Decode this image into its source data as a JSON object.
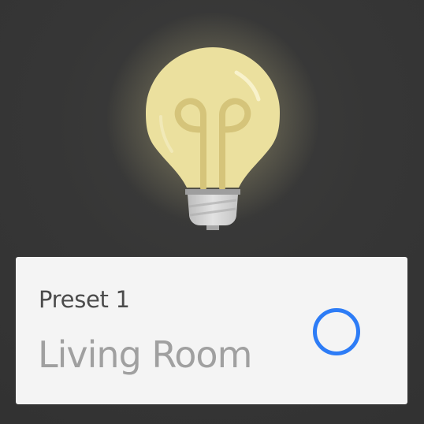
{
  "card": {
    "preset_label": "Preset 1",
    "room_name": "Living Room",
    "selected": false
  },
  "icons": {
    "bulb": "light-bulb-icon",
    "radio": "radio-button-icon"
  },
  "colors": {
    "background": "#333333",
    "bulb_glass": "#ebe09e",
    "bulb_filament": "#d5c47a",
    "card_background": "#f4f4f4",
    "preset_text": "#4b4b4b",
    "room_text": "#a0a0a0",
    "accent": "#2d7cf6"
  }
}
